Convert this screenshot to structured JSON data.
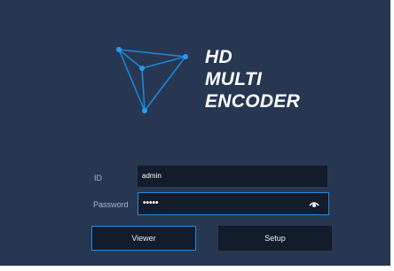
{
  "product": {
    "name_lines": [
      "HD",
      "MULTI",
      "ENCODER"
    ]
  },
  "login": {
    "id_label": "ID",
    "id_value": "admin",
    "password_label": "Password",
    "password_value": "•••••",
    "show_password_icon": "eye-icon"
  },
  "buttons": {
    "viewer_label": "Viewer",
    "setup_label": "Setup"
  },
  "colors": {
    "panel_background": "#273752",
    "input_background": "#121c2a",
    "accent": "#1d8be0",
    "label_text": "#a9b6cc",
    "logo_lines": "#1c86d8"
  },
  "logo_icon": "pyramid-logo-icon"
}
